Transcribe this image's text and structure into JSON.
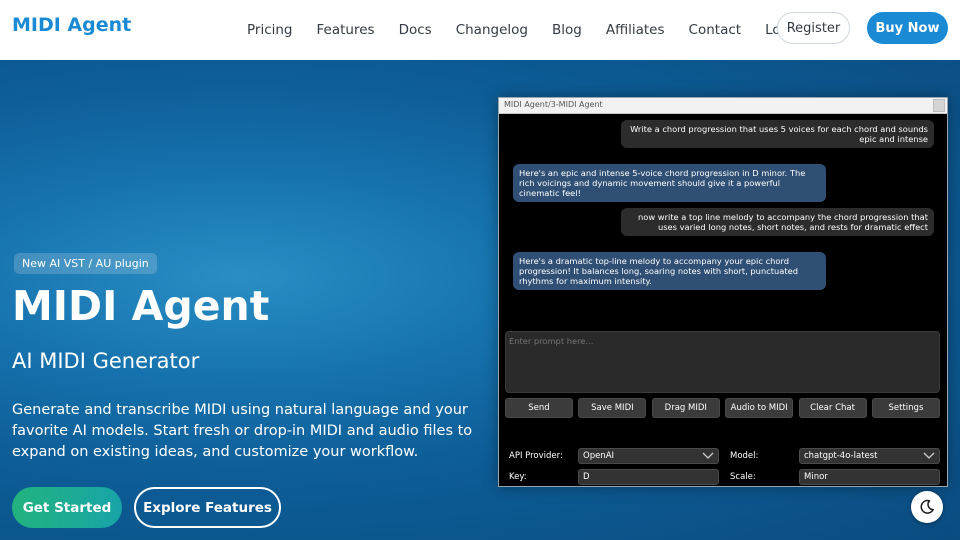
{
  "nav": {
    "brand": "MIDI Agent",
    "links": [
      "Pricing",
      "Features",
      "Docs",
      "Changelog",
      "Blog",
      "Affiliates",
      "Contact",
      "Login"
    ],
    "register": "Register",
    "buy": "Buy Now"
  },
  "hero": {
    "badge": "New AI VST / AU plugin",
    "title": "MIDI Agent",
    "subtitle": "AI MIDI Generator",
    "description": "Generate and transcribe MIDI using natural language and your favorite AI models. Start fresh or drop-in MIDI and audio files to expand on existing ideas, and customize your workflow.",
    "get_started": "Get Started",
    "explore": "Explore Features"
  },
  "plugin": {
    "title": "MIDI Agent/3-MIDI Agent",
    "messages": [
      {
        "role": "user",
        "text": "Write a chord progression that uses 5 voices for each chord and sounds epic and intense"
      },
      {
        "role": "ai",
        "text": "Here's an epic and intense 5-voice chord progression in D minor. The rich voicings and dynamic movement should give it a powerful cinematic feel!"
      },
      {
        "role": "user",
        "text": "now write a top line melody to accompany the chord progression that uses varied long notes, short notes, and rests for dramatic effect"
      },
      {
        "role": "ai",
        "text": "Here's a dramatic top-line melody to accompany your epic chord progression! It balances long, soaring notes with short, punctuated rhythms for maximum intensity."
      }
    ],
    "prompt_placeholder": "Enter prompt here...",
    "buttons": [
      "Send",
      "Save MIDI",
      "Drag MIDI",
      "Audio to MIDI",
      "Clear Chat",
      "Settings"
    ],
    "settings": {
      "api_provider_label": "API Provider:",
      "api_provider_value": "OpenAI",
      "model_label": "Model:",
      "model_value": "chatgpt-4o-latest",
      "key_label": "Key:",
      "key_value": "D",
      "scale_label": "Scale:",
      "scale_value": "Minor"
    }
  },
  "icons": {
    "dark_mode": "moon-icon",
    "dropdown": "chevron-down-icon"
  },
  "colors": {
    "brand": "#1a8ad4",
    "hero_bg": "#0d5c96",
    "cta_green": "#22b37f",
    "ai_bubble": "#2f4f74",
    "user_bubble": "#2c2c2c"
  }
}
